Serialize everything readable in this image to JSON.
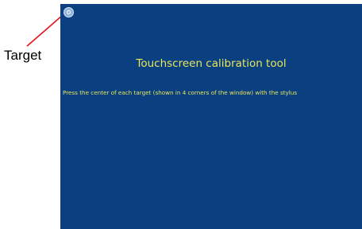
{
  "annotation": {
    "label": "Target",
    "line_color": "#e0151b"
  },
  "calibration_window": {
    "background_color": "#0a3f80",
    "text_color": "#e9e55c",
    "title": "Touchscreen calibration tool",
    "instructions": "Press the center of each target (shown in 4 corners of the window) with the stylus",
    "target_icon": "crosshair-target-icon"
  }
}
